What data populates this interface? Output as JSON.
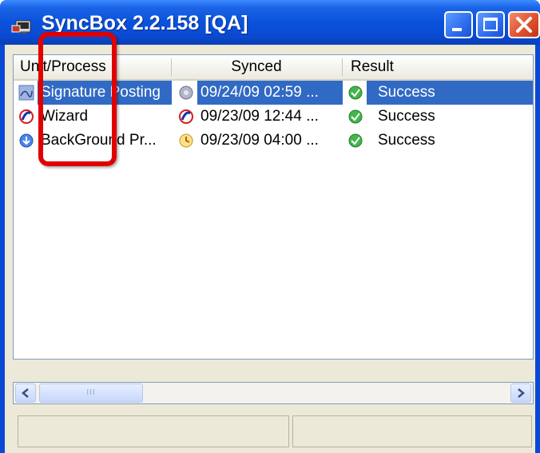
{
  "window": {
    "title": "SyncBox 2.2.158 [QA]",
    "app_icon": "syncbox-app-icon",
    "controls": [
      "minimize-icon",
      "maximize-icon",
      "close-icon"
    ]
  },
  "toolbar": {
    "buttons": [
      {
        "icon": "folder-icon"
      },
      {
        "icon": "settings-icon"
      },
      {
        "icon": "stop-icon"
      },
      {
        "icon": "edit-icon"
      },
      {
        "icon": "remove-icon"
      },
      {
        "icon": "add-icon"
      },
      {
        "icon": "import-icon"
      },
      {
        "icon": "export-icon"
      },
      {
        "icon": "key-icon"
      },
      {
        "icon": "download-icon"
      },
      {
        "icon": "schedule-icon"
      }
    ]
  },
  "list": {
    "columns": [
      "Unit/Process",
      "Synced",
      "Result"
    ],
    "rows": [
      {
        "name": "Signature Posting",
        "synced": "09/24/09 02:59 ...",
        "result": "Success",
        "selected": true
      },
      {
        "name": "Wizard",
        "synced": "09/23/09 12:44 ...",
        "result": "Success",
        "selected": false
      },
      {
        "name": "BackGround Pr...",
        "synced": "09/23/09 04:00 ...",
        "result": "Success",
        "selected": false
      }
    ]
  },
  "scrollbar": {
    "thumb_grip": "III"
  },
  "colors": {
    "titlebar": "#0a52dc",
    "selection": "#316ac5",
    "highlight": "#e00000",
    "success": "#43b54a"
  }
}
